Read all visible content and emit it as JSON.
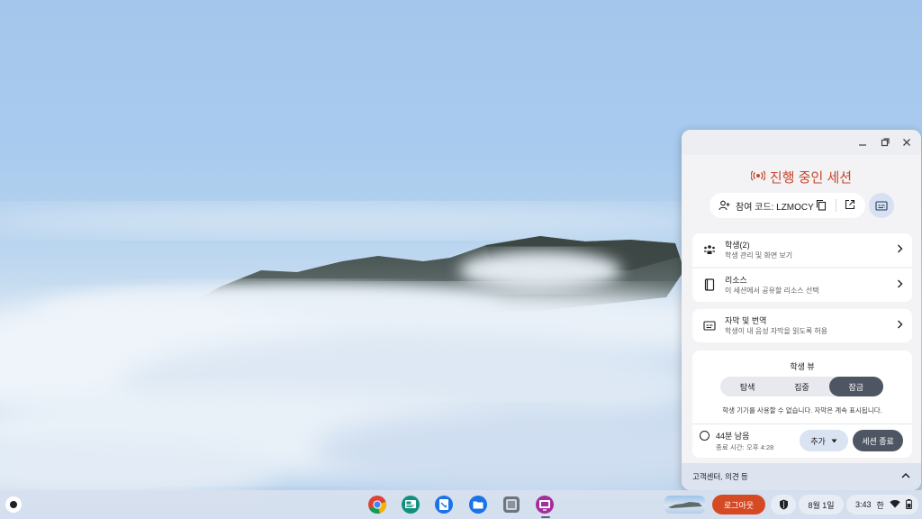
{
  "panel": {
    "session_title": "진행 중인 세션",
    "join_code": "참여 코드: LZMOCY",
    "rows": [
      {
        "title": "학생(2)",
        "subtitle": "학생 관리 및 화면 보기"
      },
      {
        "title": "리소스",
        "subtitle": "이 세션에서 공유할 리소스 선택"
      },
      {
        "title": "자막 및 번역",
        "subtitle": "학생이 내 음성 자막을 읽도록 허용"
      }
    ],
    "student_view": {
      "title": "학생 뷰",
      "options": [
        "탐색",
        "집중",
        "잠금"
      ],
      "selected": "잠금",
      "note": "학생 기기를 사용할 수 없습니다. 자막은 계속 표시됩니다."
    },
    "time": {
      "remaining": "44분 남음",
      "end": "종료 시간: 오후 4:28",
      "add_label": "추가",
      "end_label": "세션 종료"
    },
    "help": "고객센터, 의견 등"
  },
  "shelf": {
    "apps": [
      "chrome-icon",
      "classroom-icon",
      "docs-icon",
      "files-icon",
      "app-icon",
      "class-tools-icon"
    ],
    "logout_label": "로그아웃",
    "date": "8월 1일",
    "time": "3:43",
    "ime": "한"
  },
  "colors": {
    "accent": "#c8462a",
    "logout": "#d64a23",
    "active_segment": "#4f5663"
  }
}
